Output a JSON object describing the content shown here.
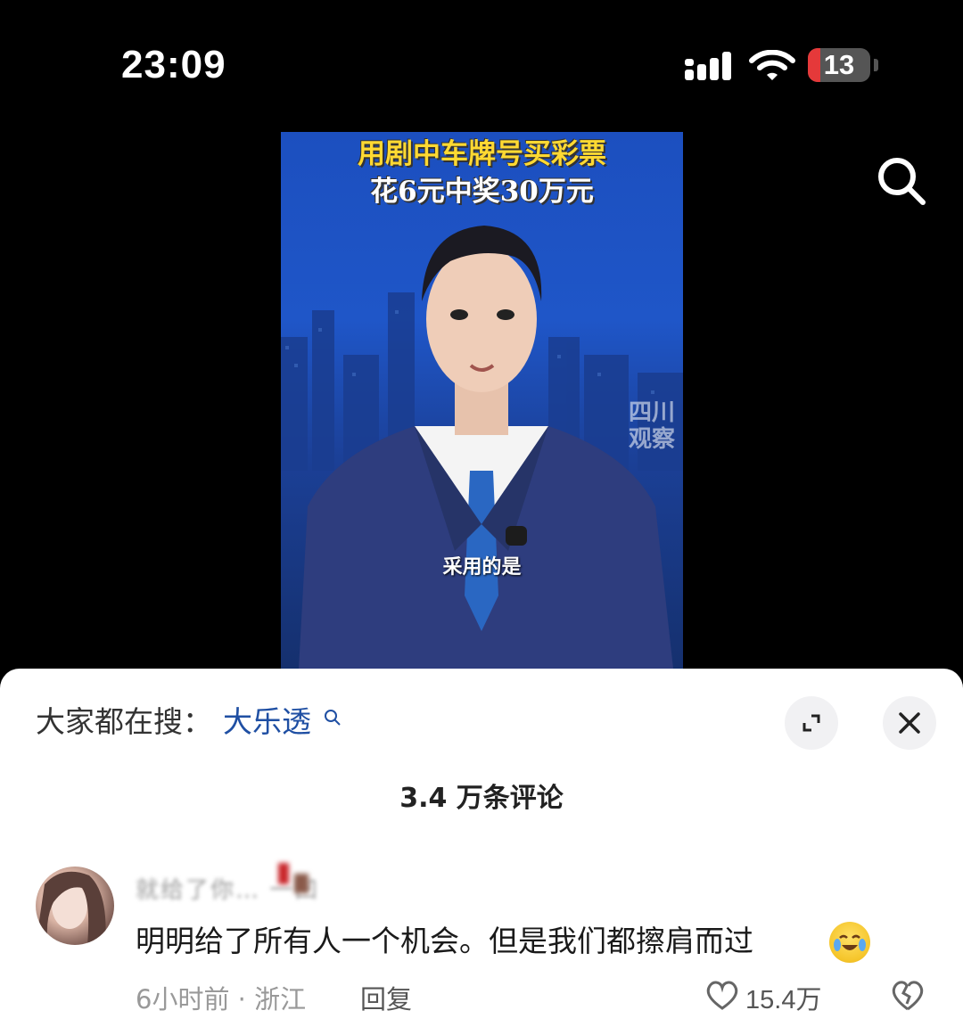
{
  "status_bar": {
    "time": "23:09",
    "battery_level": "13",
    "icons": [
      "cellular-signal-icon",
      "wifi-icon",
      "battery-icon"
    ]
  },
  "top_actions": {
    "search_icon": "search-icon"
  },
  "video": {
    "title_line1": "用剧中车牌号买彩票",
    "title_line2": "花6元中奖30万元",
    "watermark": "四川观察",
    "caption": "采用的是"
  },
  "comment_sheet": {
    "hot_search_label": "大家都在搜：",
    "hot_search_keyword": "大乐透",
    "comment_count": "3.4 万条评论",
    "colors": {
      "keyword": "#1f4fa3",
      "battery_low": "#e5393a"
    }
  },
  "comments": [
    {
      "username": "就给了你… 一凹",
      "text": "明明给了所有人一个机会。但是我们都擦肩而过",
      "emoji": "crying-laughing-emoji",
      "time_location": "6小时前 · 浙江",
      "reply_label": "回复",
      "likes": "15.4万"
    }
  ]
}
